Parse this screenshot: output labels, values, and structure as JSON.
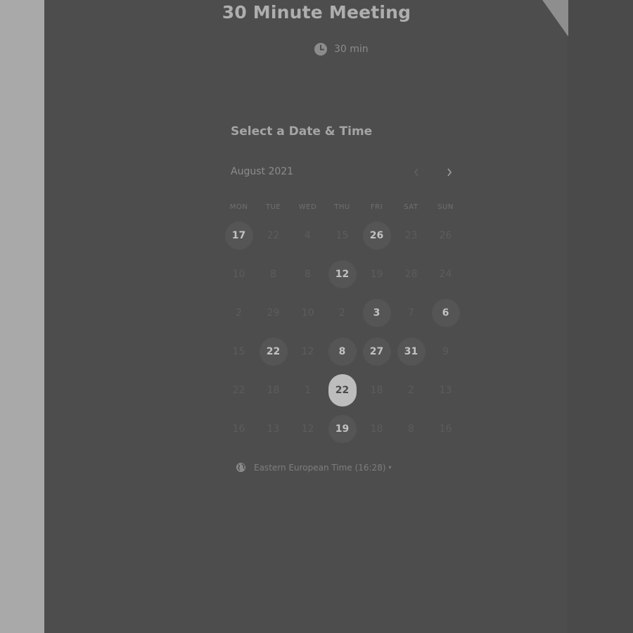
{
  "event": {
    "title": "30 Minute Meeting",
    "duration": "30 min"
  },
  "section_title": "Select a Date & Time",
  "calendar": {
    "month_label": "August 2021",
    "prev_icon": "chevron-left-icon",
    "next_icon": "chevron-right-icon",
    "weekdays": [
      "MON",
      "TUE",
      "WED",
      "THU",
      "FRI",
      "SAT",
      "SUN"
    ],
    "rows": [
      [
        "17",
        "22",
        "4",
        "15",
        "26",
        "23",
        "26"
      ],
      [
        "10",
        "8",
        "8",
        "12",
        "19",
        "28",
        "24"
      ],
      [
        "2",
        "29",
        "10",
        "2",
        "3",
        "7",
        "6"
      ],
      [
        "15",
        "22",
        "12",
        "8",
        "27",
        "31",
        "9"
      ],
      [
        "22",
        "18",
        "1",
        "22",
        "18",
        "2",
        "13"
      ],
      [
        "16",
        "13",
        "12",
        "19",
        "18",
        "8",
        "16"
      ]
    ],
    "available": [
      [
        0,
        0
      ],
      [
        0,
        4
      ],
      [
        1,
        3
      ],
      [
        2,
        4
      ],
      [
        2,
        6
      ],
      [
        3,
        1
      ],
      [
        3,
        3
      ],
      [
        3,
        4
      ],
      [
        3,
        5
      ],
      [
        5,
        3
      ]
    ],
    "selected": [
      4,
      3
    ]
  },
  "timezone": {
    "icon": "globe-icon",
    "label": "Eastern European Time (16:28)",
    "caret": "▾"
  },
  "colors": {
    "overlay_panel": "#4d4d4d",
    "selected_day": "#bdbdbd",
    "available_day": "#555555"
  }
}
